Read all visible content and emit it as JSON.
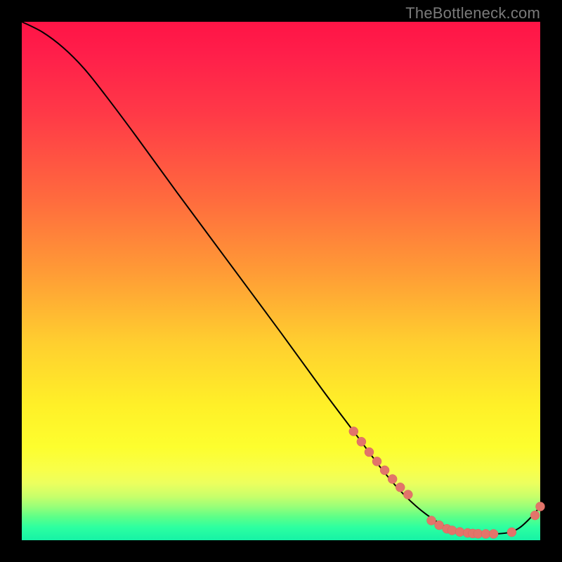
{
  "watermark": "TheBottleneck.com",
  "colors": {
    "curve_stroke": "#000000",
    "point_fill": "#e2746a",
    "point_stroke": "#d8655c"
  },
  "chart_data": {
    "type": "line",
    "title": "",
    "xlabel": "",
    "ylabel": "",
    "xlim": [
      0,
      100
    ],
    "ylim": [
      0,
      100
    ],
    "curve": {
      "name": "bottleneck-curve",
      "x": [
        0,
        4,
        8,
        12,
        16,
        22,
        30,
        40,
        50,
        58,
        64,
        70,
        74,
        78,
        82,
        85,
        88,
        91,
        94,
        96,
        98,
        100
      ],
      "y": [
        100,
        98,
        95,
        91,
        86,
        78,
        67,
        53.5,
        40,
        29,
        21,
        13,
        8.5,
        5,
        2.5,
        1.5,
        1.2,
        1.2,
        1.5,
        2.4,
        4.2,
        6.5
      ]
    },
    "series": [
      {
        "name": "highlighted-points",
        "type": "scatter",
        "x": [
          64,
          65.5,
          67,
          68.5,
          70,
          71.5,
          73,
          74.5,
          79,
          80.5,
          82,
          83,
          84.5,
          86,
          87,
          88,
          89.5,
          91,
          94.5,
          99,
          100
        ],
        "y": [
          21,
          19,
          17,
          15.2,
          13.5,
          11.8,
          10.2,
          8.8,
          3.8,
          2.9,
          2.2,
          1.9,
          1.6,
          1.4,
          1.3,
          1.25,
          1.22,
          1.22,
          1.55,
          4.8,
          6.5
        ]
      }
    ]
  }
}
